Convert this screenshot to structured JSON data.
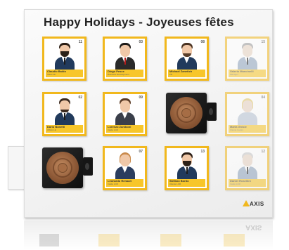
{
  "calendar": {
    "title": "Happy Holidays - Joyeuses fêtes",
    "brand": "AXIS",
    "tiles": [
      {
        "number": "11",
        "name": "Claudio Baldo",
        "role": "Sales Dir."
      },
      {
        "number": "03",
        "name": "Diego Pesce",
        "role": "Business Development"
      },
      {
        "number": "08",
        "name": "Michael Zanetich",
        "role": "PR"
      },
      {
        "number": "15",
        "name": "Valerio Mancinelli",
        "role": "Manager"
      },
      {
        "number": "02",
        "name": "Dario Bonetti",
        "role": "Ufficio LE"
      },
      {
        "number": "09",
        "name": "Lorenzo Zaniboni",
        "role": "Inside LCR"
      },
      {
        "number": "04",
        "name": "Maria Ghisle",
        "role": "Cliente Centro"
      },
      {
        "number": "07",
        "name": "Leonardo Renault",
        "role": "Inside LCR"
      },
      {
        "number": "13",
        "name": "Stefano Bordo",
        "role": "Cliente LCR"
      },
      {
        "number": "12",
        "name": "Daniel Rosellini",
        "role": "Inside LCR"
      }
    ]
  }
}
